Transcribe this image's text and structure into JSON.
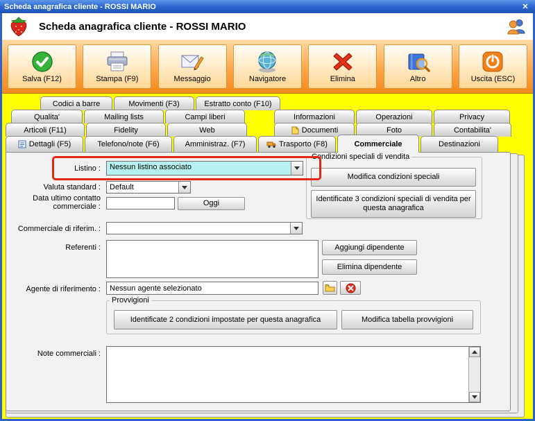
{
  "window": {
    "title": "Scheda anagrafica cliente - ROSSI MARIO",
    "close_glyph": "✕"
  },
  "header": {
    "title": "Scheda anagrafica cliente - ROSSI MARIO",
    "logo_icon": "strawberry-icon",
    "users_icon": "users-icon"
  },
  "toolbar": {
    "buttons": [
      {
        "label": "Salva (F12)",
        "icon": "save-check-icon"
      },
      {
        "label": "Stampa (F9)",
        "icon": "printer-icon"
      },
      {
        "label": "Messaggio",
        "icon": "message-icon"
      },
      {
        "label": "Navigatore",
        "icon": "navigator-globe-icon"
      },
      {
        "label": "Elimina",
        "icon": "delete-x-icon"
      },
      {
        "label": "Altro",
        "icon": "book-search-icon"
      },
      {
        "label": "Uscita (ESC)",
        "icon": "exit-power-icon"
      }
    ]
  },
  "tabs": {
    "active": "Commerciale",
    "row1": [
      {
        "label": "Codici a barre"
      },
      {
        "label": "Movimenti (F3)"
      },
      {
        "label": "Estratto conto (F10)"
      }
    ],
    "row2": [
      {
        "label": "Qualita'"
      },
      {
        "label": "Mailing lists"
      },
      {
        "label": "Campi liberi"
      },
      {
        "label": "Informazioni"
      },
      {
        "label": "Operazioni"
      },
      {
        "label": "Privacy"
      }
    ],
    "row3": [
      {
        "label": "Articoli (F11)"
      },
      {
        "label": "Fidelity"
      },
      {
        "label": "Web"
      },
      {
        "label": "Documenti",
        "icon": "document-icon"
      },
      {
        "label": "Foto"
      },
      {
        "label": "Contabilita'"
      }
    ],
    "row4": [
      {
        "label": "Dettagli (F5)",
        "icon": "details-icon"
      },
      {
        "label": "Telefono/note (F6)"
      },
      {
        "label": "Amministraz. (F7)"
      },
      {
        "label": "Trasporto (F8)",
        "icon": "truck-icon"
      },
      {
        "label": "Commerciale",
        "active": true
      },
      {
        "label": "Destinazioni"
      }
    ]
  },
  "form": {
    "listino": {
      "label": "Listino :",
      "value": "Nessun listino associato",
      "highlighted": true
    },
    "valuta": {
      "label": "Valuta standard :",
      "value": "Default"
    },
    "data_contatto": {
      "label": "Data ultimo contatto commerciale :",
      "value": "",
      "oggi_label": "Oggi"
    },
    "commerciale_riferim": {
      "label": "Commerciale di riferim. :",
      "value": ""
    },
    "referenti": {
      "label": "Referenti :",
      "value": "",
      "aggiungi_label": "Aggiungi dipendente",
      "elimina_label": "Elimina dipendente"
    },
    "agente": {
      "label": "Agente di riferimento :",
      "value": "Nessun agente selezionato",
      "folder_icon": "folder-icon",
      "remove_icon": "remove-circle-icon"
    },
    "provvigioni": {
      "title": "Provvigioni",
      "info_label": "Identificate 2 condizioni impostate per questa anagrafica",
      "modifica_label": "Modifica tabella provvigioni"
    },
    "condizioni_speciali": {
      "title": "Condizioni speciali di vendita",
      "modifica_label": "Modifica condizioni speciali",
      "info_label": "Identificate 3 condizioni speciali di vendita per questa anagrafica"
    },
    "note": {
      "label": "Note commerciali :",
      "value": ""
    }
  },
  "colors": {
    "titlebar_blue": "#2a64cc",
    "background_yellow": "#ffff00",
    "toolbar_orange": "#ffa243",
    "highlight_red": "#e22a12",
    "field_cyan": "#b6f2f2",
    "panel_gray": "#f2f2f2"
  }
}
